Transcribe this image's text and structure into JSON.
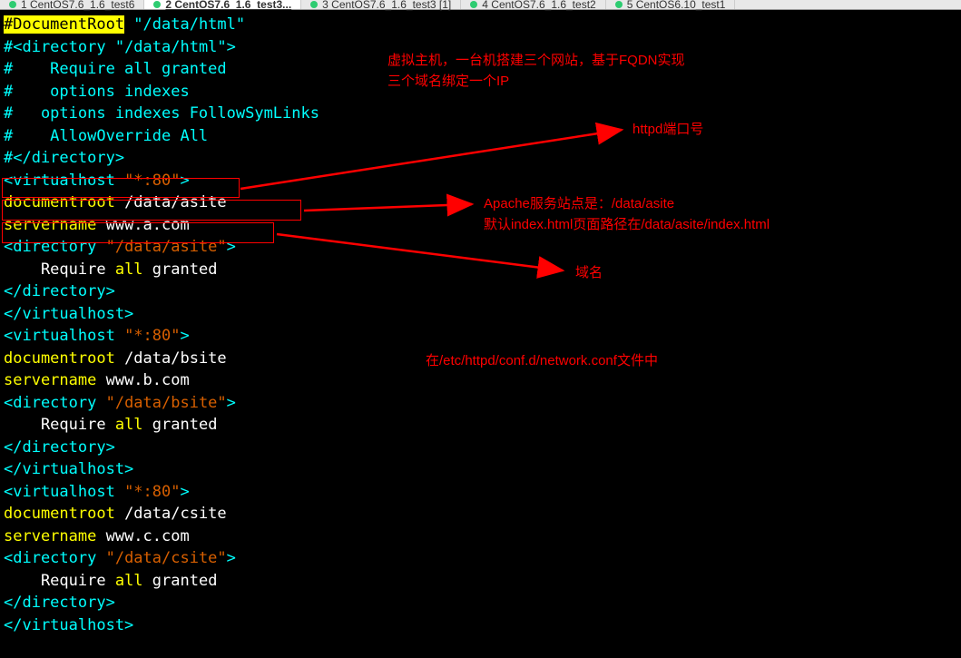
{
  "tabs": [
    {
      "label": "1 CentOS7.6_1.6_test6",
      "active": false
    },
    {
      "label": "2 CentOS7.6_1.6_test3...",
      "active": true
    },
    {
      "label": "3 CentOS7.6_1.6_test3 [1]",
      "active": false
    },
    {
      "label": "4 CentOS7.6_1.6_test2",
      "active": false
    },
    {
      "label": "5 CentOS6.10_test1",
      "active": false
    }
  ],
  "code": {
    "l1_docroot": "#DocumentRoot",
    "l1_path": " \"/data/html\"",
    "l2_open": "#<directory ",
    "l2_path": "\"/data/html\"",
    "l2_close": ">",
    "l3": "#    Require all granted",
    "l4": "#    options indexes",
    "l5": "#   options indexes FollowSymLinks",
    "l6": "#    AllowOverride All",
    "l7": "#</directory>",
    "l8_open": "<virtualhost ",
    "l8_port": "\"*:80\"",
    "l8_close": ">",
    "l9_key": "documentroot",
    "l9_val": " /data/asite",
    "l10_key": "servername",
    "l10_val": " www.a.com",
    "l11_open": "<directory ",
    "l11_path": "\"/data/asite\"",
    "l11_close": ">",
    "l12_req": "    Require ",
    "l12_all": "all",
    "l12_grant": " granted",
    "l13": "</directory>",
    "l14": "</virtualhost>",
    "l15_open": "<virtualhost ",
    "l15_port": "\"*:80\"",
    "l15_close": ">",
    "l16_key": "documentroot",
    "l16_val": " /data/bsite",
    "l17_key": "servername",
    "l17_val": " www.b.com",
    "l18_open": "<directory ",
    "l18_path": "\"/data/bsite\"",
    "l18_close": ">",
    "l19_req": "    Require ",
    "l19_all": "all",
    "l19_grant": " granted",
    "l20": "</directory>",
    "l21": "</virtualhost>",
    "l22_open": "<virtualhost ",
    "l22_port": "\"*:80\"",
    "l22_close": ">",
    "l23_key": "documentroot",
    "l23_val": " /data/csite",
    "l24_key": "servername",
    "l24_val": " www.c.com",
    "l25_open": "<directory ",
    "l25_path": "\"/data/csite\"",
    "l25_close": ">",
    "l26_req": "    Require ",
    "l26_all": "all",
    "l26_grant": " granted",
    "l27": "</directory>",
    "l28": "</virtualhost>"
  },
  "annotations": {
    "a1": "虚拟主机，一台机搭建三个网站，基于FQDN实现",
    "a2": "三个域名绑定一个IP",
    "a3": "httpd端口号",
    "a4": "Apache服务站点是：/data/asite",
    "a5": "默认index.html页面路径在/data/asite/index.html",
    "a6": "域名",
    "a7": "在/etc/httpd/conf.d/network.conf文件中"
  }
}
